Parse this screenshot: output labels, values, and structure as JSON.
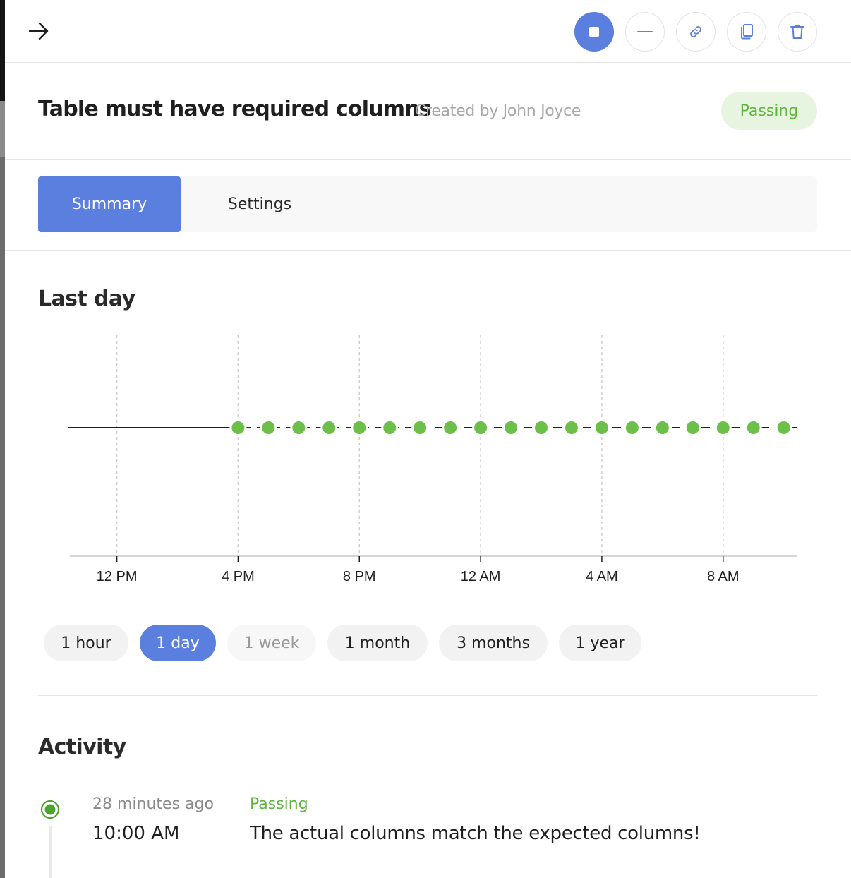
{
  "toolbar": {
    "back_icon": "arrow-right-icon",
    "actions": [
      {
        "icon": "stop-icon",
        "primary": true
      },
      {
        "icon": "minus-icon"
      },
      {
        "icon": "link-icon"
      },
      {
        "icon": "copy-icon"
      },
      {
        "icon": "trash-icon"
      }
    ]
  },
  "header": {
    "title": "Table must have required columns",
    "created_by": "Created by John Joyce",
    "status": "Passing"
  },
  "tabs": [
    {
      "label": "Summary",
      "active": true
    },
    {
      "label": "Settings",
      "active": false
    }
  ],
  "summary": {
    "section_title": "Last day"
  },
  "chart_data": {
    "type": "scatter",
    "title": "",
    "xlabel": "",
    "ylabel": "",
    "x_ticks": [
      "12 PM",
      "4 PM",
      "8 PM",
      "12 AM",
      "4 AM",
      "8 AM"
    ],
    "x_tick_hours": [
      0,
      4,
      8,
      12,
      16,
      20
    ],
    "xlim": [
      -1.55,
      22.45
    ],
    "points_hours": [
      4,
      5,
      6,
      7,
      8,
      9,
      10,
      11,
      12,
      13,
      14,
      15,
      16,
      17,
      18,
      19,
      20,
      21,
      22
    ],
    "point_status": "Passing",
    "grid": true,
    "point_color": "#6cc04a"
  },
  "time_ranges": [
    {
      "label": "1 hour",
      "state": "normal"
    },
    {
      "label": "1 day",
      "state": "active"
    },
    {
      "label": "1 week",
      "state": "disabled"
    },
    {
      "label": "1 month",
      "state": "normal"
    },
    {
      "label": "3 months",
      "state": "normal"
    },
    {
      "label": "1 year",
      "state": "normal"
    }
  ],
  "activity": {
    "section_title": "Activity",
    "items": [
      {
        "ago": "28 minutes ago",
        "time": "10:00 AM",
        "status": "Passing",
        "message": "The actual columns match the expected columns!"
      }
    ]
  },
  "colors": {
    "accent": "#5b7fde",
    "passing": "#6cc04a",
    "passing_pill_bg": "#e7f4df"
  }
}
